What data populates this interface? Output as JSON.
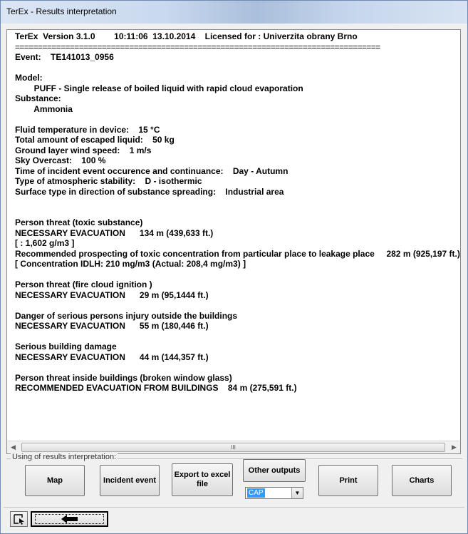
{
  "window": {
    "title": "TerEx - Results interpretation"
  },
  "report": {
    "lines": [
      "TerEx  Version 3.1.0        10:11:06  13.10.2014    Licensed for : Univerzita obrany Brno",
      "================================================================================",
      "Event:    TE141013_0956",
      "",
      "Model:",
      "        PUFF - Single release of boiled liquid with rapid cloud evaporation",
      "Substance:",
      "        Ammonia",
      "",
      "Fluid temperature in device:    15 °C",
      "Total amount of escaped liquid:    50 kg",
      "Ground layer wind speed:    1 m/s",
      "Sky Overcast:    100 %",
      "Time of incident event occurence and continuance:    Day - Autumn",
      "Type of atmospheric stability:    D - isothermic",
      "Surface type in direction of substance spreading:    Industrial area",
      "",
      "",
      "Person threat (toxic substance)",
      "NECESSARY EVACUATION      134 m (439,633 ft.)",
      "[ : 1,602 g/m3 ]",
      "Recommended prospecting of toxic concentration from particular place to leakage place     282 m (925,197 ft.)",
      "[ Concentration IDLH: 210 mg/m3 (Actual: 208,4 mg/m3) ]",
      "",
      "Person threat (fire cloud ignition )",
      "NECESSARY EVACUATION      29 m (95,1444 ft.)",
      "",
      "Danger of serious persons injury outside the buildings",
      "NECESSARY EVACUATION      55 m (180,446 ft.)",
      "",
      "Serious building damage",
      "NECESSARY EVACUATION      44 m (144,357 ft.)",
      "",
      "Person threat inside buildings (broken window glass)",
      "RECOMMENDED EVACUATION FROM BUILDINGS    84 m (275,591 ft.)"
    ]
  },
  "group": {
    "label": "Using of results interpretation:"
  },
  "buttons": {
    "map": "Map",
    "incident_event": "Incident event",
    "export_line1": "Export to excel",
    "export_line2": "file",
    "other_outputs": "Other outputs",
    "print": "Print",
    "charts": "Charts"
  },
  "outputs_select": {
    "value": "CAP"
  },
  "scrollbar": {
    "thumb_glyph": "III"
  },
  "icons": {
    "view": "view-icon",
    "back": "back-arrow-icon"
  }
}
